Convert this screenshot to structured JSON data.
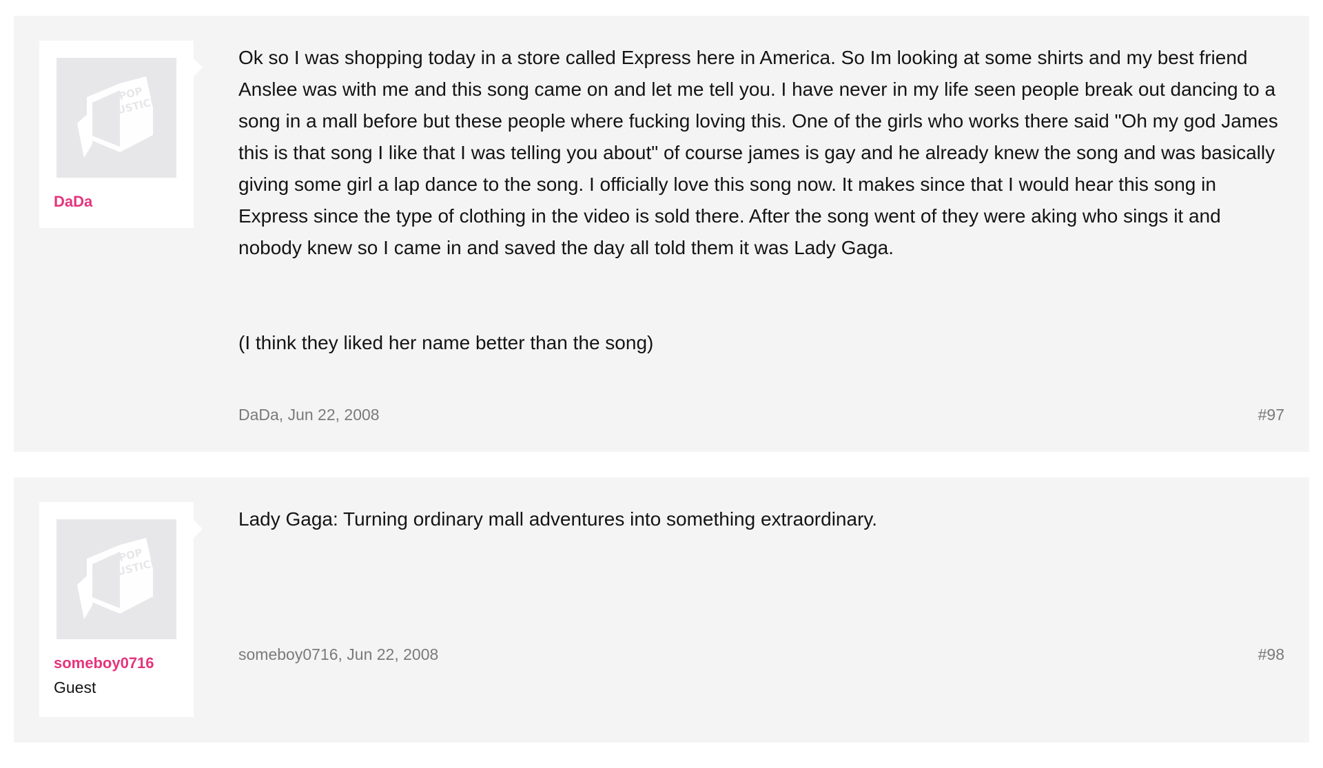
{
  "posts": [
    {
      "username": "DaDa",
      "user_title": "",
      "avatar_icon": "popjustice-default-avatar-icon",
      "paragraphs": [
        "Ok so I was shopping today in a store called Express here in America. So Im looking at some shirts and my best friend Anslee was with me and this song came on and let me tell you. I have never in my life seen people break out dancing to a song in a mall before but these people where fucking loving this. One of the girls who works there said \"Oh my god James this is that song I like that I was telling you about\" of course james is gay and he already knew the song and was basically giving some girl a lap dance to the song. I officially love this song now. It makes since that I would hear this song in Express since the type of clothing in the video is sold there. After the song went of they were aking who sings it and nobody knew so I came in and saved the day all told them it was Lady Gaga.",
        "(I think they liked her name better than the song)"
      ],
      "meta": "DaDa, Jun 22, 2008",
      "number": "#97"
    },
    {
      "username": "someboy0716",
      "user_title": "Guest",
      "avatar_icon": "popjustice-default-avatar-icon",
      "paragraphs": [
        "Lady Gaga: Turning ordinary mall adventures into something extraordinary."
      ],
      "meta": "someboy0716, Jun 22, 2008",
      "number": "#98"
    }
  ],
  "colors": {
    "username": "#e4347c",
    "post_background": "#f4f4f4",
    "meta_text": "#7a7a7a",
    "avatar_background": "#e7e7ea"
  }
}
